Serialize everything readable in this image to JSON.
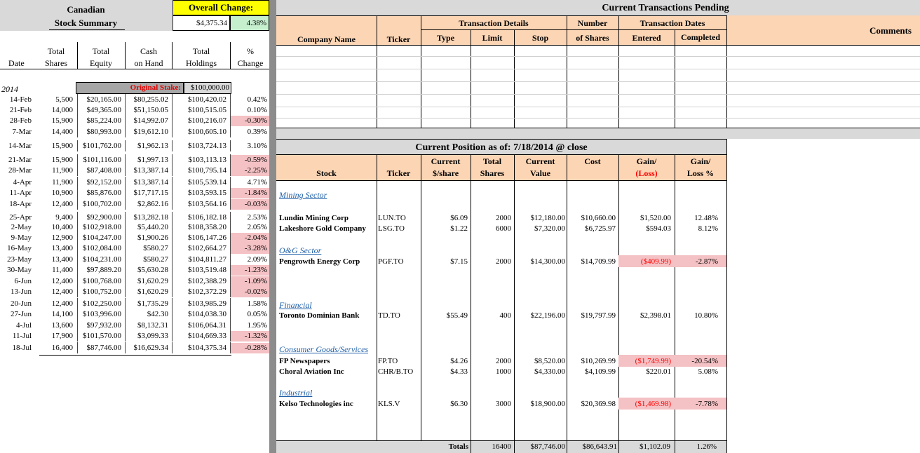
{
  "summary": {
    "title_line1": "Canadian",
    "title_line2": "Stock Summary",
    "overall_label": "Overall Change:",
    "overall_value": "$4,375.34",
    "overall_pct": "4.38%",
    "headers": {
      "total_shares": [
        "Total",
        "Shares"
      ],
      "total_equity": [
        "Total",
        "Equity"
      ],
      "cash": [
        "Cash",
        "on Hand"
      ],
      "total_holdings": [
        "Total",
        "Holdings"
      ],
      "pct_change": [
        "%",
        "Change"
      ],
      "date": "Date"
    },
    "year": "2014",
    "original_stake_label": "Original Stake:",
    "original_stake_value": "$100,000.00",
    "rows": [
      {
        "date": "14-Feb",
        "shares": "5,500",
        "equity": "$20,165.00",
        "cash": "$80,255.02",
        "holdings": "$100,420.02",
        "pct": "0.42%",
        "neg": false
      },
      {
        "date": "21-Feb",
        "shares": "14,000",
        "equity": "$49,365.00",
        "cash": "$51,150.05",
        "holdings": "$100,515.05",
        "pct": "0.10%",
        "neg": false
      },
      {
        "date": "28-Feb",
        "shares": "15,900",
        "equity": "$85,224.00",
        "cash": "$14,992.07",
        "holdings": "$100,216.07",
        "pct": "-0.30%",
        "neg": true
      },
      {
        "date": "7-Mar",
        "shares": "14,400",
        "equity": "$80,993.00",
        "cash": "$19,612.10",
        "holdings": "$100,605.10",
        "pct": "0.39%",
        "neg": false
      },
      {
        "date": "14-Mar",
        "shares": "15,900",
        "equity": "$101,762.00",
        "cash": "$1,962.13",
        "holdings": "$103,724.13",
        "pct": "3.10%",
        "neg": false
      },
      {
        "date": "21-Mar",
        "shares": "15,900",
        "equity": "$101,116.00",
        "cash": "$1,997.13",
        "holdings": "$103,113.13",
        "pct": "-0.59%",
        "neg": true
      },
      {
        "date": "28-Mar",
        "shares": "11,900",
        "equity": "$87,408.00",
        "cash": "$13,387.14",
        "holdings": "$100,795.14",
        "pct": "-2.25%",
        "neg": true
      },
      {
        "date": "4-Apr",
        "shares": "11,900",
        "equity": "$92,152.00",
        "cash": "$13,387.14",
        "holdings": "$105,539.14",
        "pct": "4.71%",
        "neg": false
      },
      {
        "date": "11-Apr",
        "shares": "10,900",
        "equity": "$85,876.00",
        "cash": "$17,717.15",
        "holdings": "$103,593.15",
        "pct": "-1.84%",
        "neg": true
      },
      {
        "date": "18-Apr",
        "shares": "12,400",
        "equity": "$100,702.00",
        "cash": "$2,862.16",
        "holdings": "$103,564.16",
        "pct": "-0.03%",
        "neg": true
      },
      {
        "date": "25-Apr",
        "shares": "9,400",
        "equity": "$92,900.00",
        "cash": "$13,282.18",
        "holdings": "$106,182.18",
        "pct": "2.53%",
        "neg": false
      },
      {
        "date": "2-May",
        "shares": "10,400",
        "equity": "$102,918.00",
        "cash": "$5,440.20",
        "holdings": "$108,358.20",
        "pct": "2.05%",
        "neg": false
      },
      {
        "date": "9-May",
        "shares": "12,900",
        "equity": "$104,247.00",
        "cash": "$1,900.26",
        "holdings": "$106,147.26",
        "pct": "-2.04%",
        "neg": true
      },
      {
        "date": "16-May",
        "shares": "13,400",
        "equity": "$102,084.00",
        "cash": "$580.27",
        "holdings": "$102,664.27",
        "pct": "-3.28%",
        "neg": true
      },
      {
        "date": "23-May",
        "shares": "13,400",
        "equity": "$104,231.00",
        "cash": "$580.27",
        "holdings": "$104,811.27",
        "pct": "2.09%",
        "neg": false
      },
      {
        "date": "30-May",
        "shares": "11,400",
        "equity": "$97,889.20",
        "cash": "$5,630.28",
        "holdings": "$103,519.48",
        "pct": "-1.23%",
        "neg": true
      },
      {
        "date": "6-Jun",
        "shares": "12,400",
        "equity": "$100,768.00",
        "cash": "$1,620.29",
        "holdings": "$102,388.29",
        "pct": "-1.09%",
        "neg": true
      },
      {
        "date": "13-Jun",
        "shares": "12,400",
        "equity": "$100,752.00",
        "cash": "$1,620.29",
        "holdings": "$102,372.29",
        "pct": "-0.02%",
        "neg": true
      },
      {
        "date": "20-Jun",
        "shares": "12,400",
        "equity": "$102,250.00",
        "cash": "$1,735.29",
        "holdings": "$103,985.29",
        "pct": "1.58%",
        "neg": false
      },
      {
        "date": "27-Jun",
        "shares": "14,100",
        "equity": "$103,996.00",
        "cash": "$42.30",
        "holdings": "$104,038.30",
        "pct": "0.05%",
        "neg": false
      },
      {
        "date": "4-Jul",
        "shares": "13,600",
        "equity": "$97,932.00",
        "cash": "$8,132.31",
        "holdings": "$106,064.31",
        "pct": "1.95%",
        "neg": false
      },
      {
        "date": "11-Jul",
        "shares": "17,900",
        "equity": "$101,570.00",
        "cash": "$3,099.33",
        "holdings": "$104,669.33",
        "pct": "-1.32%",
        "neg": true
      },
      {
        "date": "18-Jul",
        "shares": "16,400",
        "equity": "$87,746.00",
        "cash": "$16,629.34",
        "holdings": "$104,375.34",
        "pct": "-0.28%",
        "neg": true
      }
    ]
  },
  "pending": {
    "title": "Current Transactions Pending",
    "group_details": "Transaction Details",
    "group_number": "Number",
    "group_dates": "Transaction Dates",
    "cols": {
      "company": "Company Name",
      "ticker": "Ticker",
      "type": "Type",
      "limit": "Limit",
      "stop": "Stop",
      "shares": "of Shares",
      "entered": "Entered",
      "completed": "Completed",
      "comments": "Comments"
    }
  },
  "position": {
    "title": "Current Position as of:  7/18/2014  @ close",
    "cols": {
      "stock": "Stock",
      "ticker": "Ticker",
      "price": [
        "Current",
        "$/share"
      ],
      "shares": [
        "Total",
        "Shares"
      ],
      "value": [
        "Current",
        "Value"
      ],
      "cost": "Cost",
      "gain": [
        "Gain/",
        "(Loss)"
      ],
      "gain_pct": [
        "Gain/",
        "Loss %"
      ]
    },
    "sectors": {
      "mining": "Mining Sector",
      "og": "O&G Sector",
      "financial": "Financial",
      "consumer": "Consumer Goods/Services",
      "industrial": "Industrial"
    },
    "holdings": {
      "lundin": {
        "stock": "Lundin Mining Corp",
        "ticker": "LUN.TO",
        "price": "$6.09",
        "shares": "2000",
        "value": "$12,180.00",
        "cost": "$10,660.00",
        "gain": "$1,520.00",
        "gain_pct": "12.48%"
      },
      "lakeshore": {
        "stock": "Lakeshore Gold Company",
        "ticker": "LSG.TO",
        "price": "$1.22",
        "shares": "6000",
        "value": "$7,320.00",
        "cost": "$6,725.97",
        "gain": "$594.03",
        "gain_pct": "8.12%"
      },
      "pengrowth": {
        "stock": "Pengrowth Energy Corp",
        "ticker": "PGF.TO",
        "price": "$7.15",
        "shares": "2000",
        "value": "$14,300.00",
        "cost": "$14,709.99",
        "gain": "($409.99)",
        "gain_pct": "-2.87%"
      },
      "td": {
        "stock": "Toronto Dominian Bank",
        "ticker": "TD.TO",
        "price": "$55.49",
        "shares": "400",
        "value": "$22,196.00",
        "cost": "$19,797.99",
        "gain": "$2,398.01",
        "gain_pct": "10.80%"
      },
      "fp": {
        "stock": "FP Newspapers",
        "ticker": "FP.TO",
        "price": "$4.26",
        "shares": "2000",
        "value": "$8,520.00",
        "cost": "$10,269.99",
        "gain": "($1,749.99)",
        "gain_pct": "-20.54%"
      },
      "choral": {
        "stock": "Choral Aviation Inc",
        "ticker": "CHR/B.TO",
        "price": "$4.33",
        "shares": "1000",
        "value": "$4,330.00",
        "cost": "$4,109.99",
        "gain": "$220.01",
        "gain_pct": "5.08%"
      },
      "kelso": {
        "stock": "Kelso Technologies inc",
        "ticker": "KLS.V",
        "price": "$6.30",
        "shares": "3000",
        "value": "$18,900.00",
        "cost": "$20,369.98",
        "gain": "($1,469.98)",
        "gain_pct": "-7.78%"
      }
    },
    "totals": {
      "label": "Totals",
      "shares": "16400",
      "value": "$87,746.00",
      "cost": "$86,643.91",
      "gain": "$1,102.09",
      "gain_pct": "1.26%"
    }
  },
  "colors": {
    "header_gray": "#d9d9d9",
    "header_orange": "#fcd5b4",
    "yellow": "#ffff00",
    "green": "#c6efce",
    "pink": "#f4c1c4",
    "separator": "#8c8c8c"
  }
}
